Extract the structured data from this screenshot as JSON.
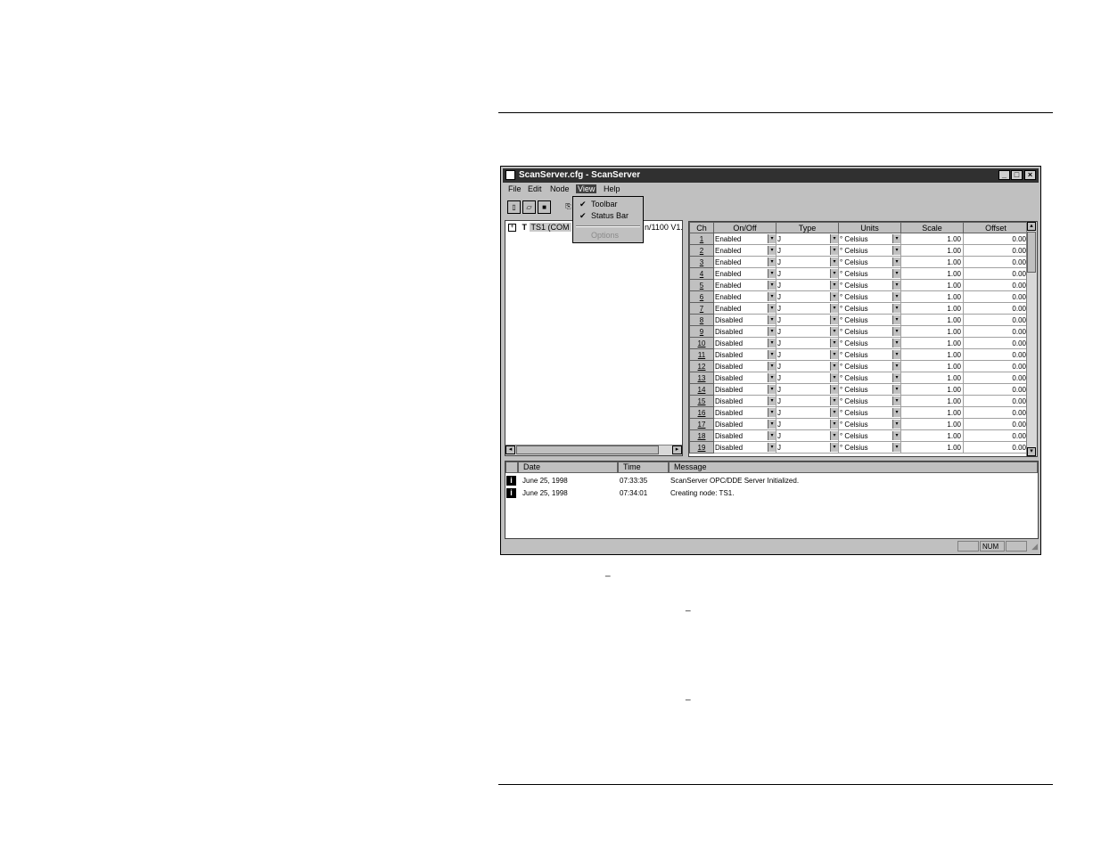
{
  "window": {
    "title": "ScanServer.cfg - ScanServer",
    "minimize_glyph": "_",
    "maximize_glyph": "□",
    "close_glyph": "×"
  },
  "menu": {
    "items": [
      "File",
      "Edit",
      "Node",
      "View",
      "Help"
    ],
    "active": "View",
    "view_dropdown": {
      "toolbar": "Toolbar",
      "status_bar": "Status Bar",
      "options": "Options",
      "check": "✔"
    }
  },
  "toolbar": {
    "new_glyph": "▯",
    "open_glyph": "▱",
    "save_glyph": "■",
    "extra_glyph": "⎘"
  },
  "tree": {
    "expand_glyph": "+",
    "node_prefix": "T",
    "node_label": "TS1 (COM",
    "node_tail": "n/1100 V1."
  },
  "grid": {
    "headers": [
      "Ch",
      "On/Off",
      "Type",
      "Units",
      "Scale",
      "Offset"
    ],
    "rows": [
      [
        "1",
        "Enabled",
        "J",
        "° Celsius",
        "1.00",
        "0.00"
      ],
      [
        "2",
        "Enabled",
        "J",
        "° Celsius",
        "1.00",
        "0.00"
      ],
      [
        "3",
        "Enabled",
        "J",
        "° Celsius",
        "1.00",
        "0.00"
      ],
      [
        "4",
        "Enabled",
        "J",
        "° Celsius",
        "1.00",
        "0.00"
      ],
      [
        "5",
        "Enabled",
        "J",
        "° Celsius",
        "1.00",
        "0.00"
      ],
      [
        "6",
        "Enabled",
        "J",
        "° Celsius",
        "1.00",
        "0.00"
      ],
      [
        "7",
        "Enabled",
        "J",
        "° Celsius",
        "1.00",
        "0.00"
      ],
      [
        "8",
        "Disabled",
        "J",
        "° Celsius",
        "1.00",
        "0.00"
      ],
      [
        "9",
        "Disabled",
        "J",
        "° Celsius",
        "1.00",
        "0.00"
      ],
      [
        "10",
        "Disabled",
        "J",
        "° Celsius",
        "1.00",
        "0.00"
      ],
      [
        "11",
        "Disabled",
        "J",
        "° Celsius",
        "1.00",
        "0.00"
      ],
      [
        "12",
        "Disabled",
        "J",
        "° Celsius",
        "1.00",
        "0.00"
      ],
      [
        "13",
        "Disabled",
        "J",
        "° Celsius",
        "1.00",
        "0.00"
      ],
      [
        "14",
        "Disabled",
        "J",
        "° Celsius",
        "1.00",
        "0.00"
      ],
      [
        "15",
        "Disabled",
        "J",
        "° Celsius",
        "1.00",
        "0.00"
      ],
      [
        "16",
        "Disabled",
        "J",
        "° Celsius",
        "1.00",
        "0.00"
      ],
      [
        "17",
        "Disabled",
        "J",
        "° Celsius",
        "1.00",
        "0.00"
      ],
      [
        "18",
        "Disabled",
        "J",
        "° Celsius",
        "1.00",
        "0.00"
      ],
      [
        "19",
        "Disabled",
        "J",
        "° Celsius",
        "1.00",
        "0.00"
      ]
    ]
  },
  "log": {
    "headers": [
      "Date",
      "Time",
      "Message"
    ],
    "rows": [
      {
        "icon": "i",
        "date": "June 25, 1998",
        "time": "07:33:35",
        "message": "ScanServer OPC/DDE Server Initialized."
      },
      {
        "icon": "i",
        "date": "June 25, 1998",
        "time": "07:34:01",
        "message": "Creating node: TS1."
      }
    ]
  },
  "status_bar": {
    "num": "NUM"
  },
  "page_marks": {
    "dash": "_"
  }
}
